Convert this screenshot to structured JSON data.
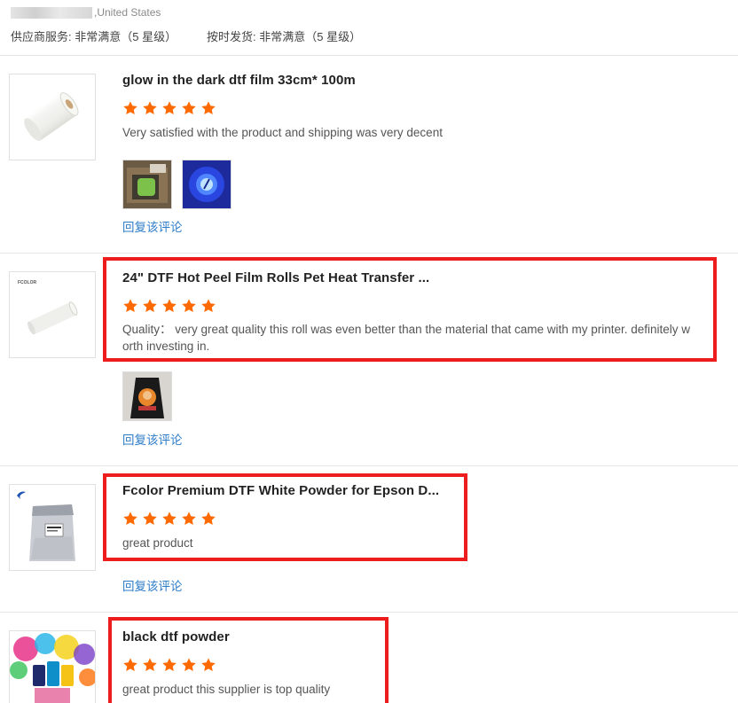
{
  "reviewer": {
    "location": ",United States"
  },
  "ratings": {
    "supplier_service": "供应商服务: 非常满意（5 星级）",
    "on_time_shipping": "按时发货: 非常满意（5 星级）"
  },
  "colors": {
    "star": "#ff6a00",
    "highlight_box": "#ee1d1d",
    "link": "#2e7cc8"
  },
  "reviews": [
    {
      "product_title": "glow in the dark dtf film 33cm* 100m",
      "stars": 5,
      "text": "Very satisfied with the product and shipping was very decent",
      "photos": 2,
      "reply_label": "回复该评论",
      "highlighted": false
    },
    {
      "product_title": "24\" DTF Hot Peel Film Rolls Pet Heat Transfer ...",
      "thumb_brand": "FCOLOR",
      "stars": 5,
      "text_line1": "Quality： very great quality this roll was even better than the material that came with my printer. definitely w",
      "text_line2": "orth investing in.",
      "photos": 1,
      "reply_label": "回复该评论",
      "highlighted": true
    },
    {
      "product_title": "Fcolor Premium DTF White Powder for Epson D...",
      "stars": 5,
      "text": "great product",
      "reply_label": "回复该评论",
      "highlighted": true
    },
    {
      "product_title": "black dtf powder",
      "stars": 5,
      "text": "great product this supplier is top quality",
      "highlighted": true
    }
  ]
}
